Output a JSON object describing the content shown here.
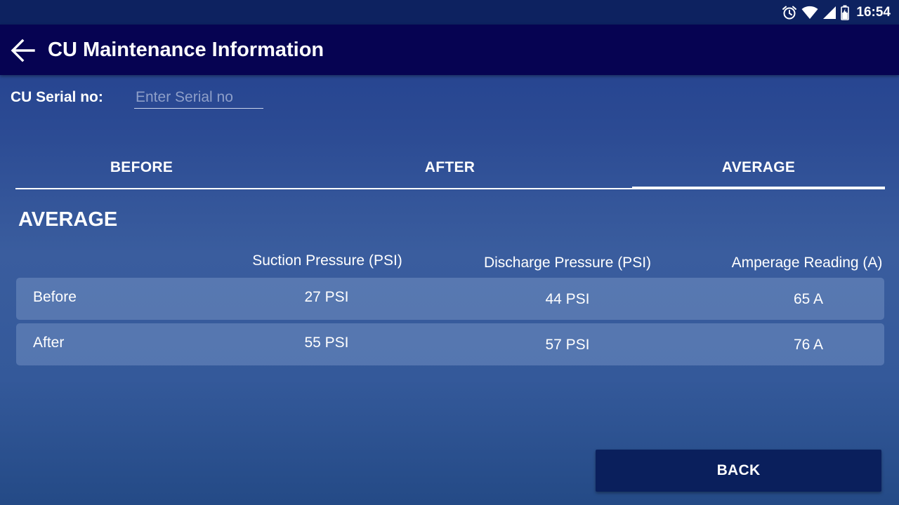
{
  "status_bar": {
    "time": "16:54",
    "icons": [
      "alarm-icon",
      "wifi-icon",
      "signal-icon",
      "battery-icon"
    ]
  },
  "app_bar": {
    "title": "CU Maintenance Information",
    "back_icon": "arrow-left-icon"
  },
  "serial": {
    "label": "CU Serial no:",
    "value": "",
    "placeholder": "Enter Serial no"
  },
  "tabs": [
    {
      "label": "BEFORE",
      "selected": false
    },
    {
      "label": "AFTER",
      "selected": false
    },
    {
      "label": "AVERAGE",
      "selected": true
    }
  ],
  "section": {
    "title": "AVERAGE"
  },
  "table": {
    "headers": [
      "",
      "Suction Pressure (PSI)",
      "Discharge Pressure (PSI)",
      "Amperage Reading (A)"
    ],
    "rows": [
      {
        "label": "Before",
        "suction": "27 PSI",
        "discharge": "44 PSI",
        "amperage": "65 A"
      },
      {
        "label": "After",
        "suction": "55 PSI",
        "discharge": "57 PSI",
        "amperage": "76 A"
      }
    ]
  },
  "footer": {
    "back_label": "BACK"
  },
  "colors": {
    "status_bar": "#0d2260",
    "app_bar": "#060352",
    "button": "#0a1f5c",
    "text": "#ffffff"
  }
}
